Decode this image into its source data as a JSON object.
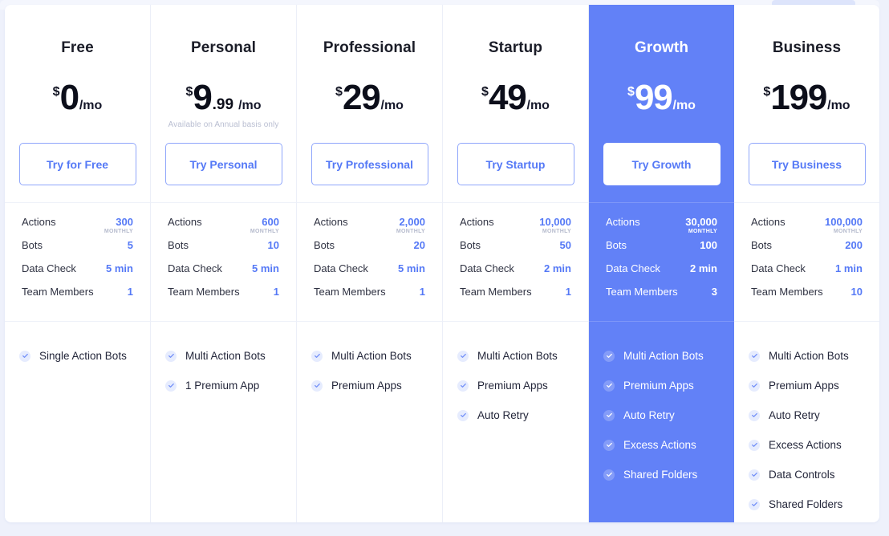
{
  "table": {
    "spec_labels": [
      "Actions",
      "Bots",
      "Data Check",
      "Team Members"
    ],
    "actions_caption": "MONTHLY",
    "accent_color": "#5579f6",
    "featured_bg_color": "#6281f7",
    "page_bg_color": "#eef1fb"
  },
  "plans": [
    {
      "name": "Free",
      "currency": "$",
      "amount": "0",
      "cents": "",
      "per": "/mo",
      "note": "",
      "cta_label": "Try for Free",
      "featured": false,
      "specs": {
        "actions": "300",
        "bots": "5",
        "data_check": "5 min",
        "team_members": "1"
      },
      "features": [
        "Single Action Bots"
      ]
    },
    {
      "name": "Personal",
      "currency": "$",
      "amount": "9",
      "cents": ".99",
      "per": "/mo",
      "note": "Available on Annual basis only",
      "cta_label": "Try Personal",
      "featured": false,
      "specs": {
        "actions": "600",
        "bots": "10",
        "data_check": "5 min",
        "team_members": "1"
      },
      "features": [
        "Multi Action Bots",
        "1 Premium App"
      ]
    },
    {
      "name": "Professional",
      "currency": "$",
      "amount": "29",
      "cents": "",
      "per": "/mo",
      "note": "",
      "cta_label": "Try Professional",
      "featured": false,
      "specs": {
        "actions": "2,000",
        "bots": "20",
        "data_check": "5 min",
        "team_members": "1"
      },
      "features": [
        "Multi Action Bots",
        "Premium Apps"
      ]
    },
    {
      "name": "Startup",
      "currency": "$",
      "amount": "49",
      "cents": "",
      "per": "/mo",
      "note": "",
      "cta_label": "Try Startup",
      "featured": false,
      "specs": {
        "actions": "10,000",
        "bots": "50",
        "data_check": "2 min",
        "team_members": "1"
      },
      "features": [
        "Multi Action Bots",
        "Premium Apps",
        "Auto Retry"
      ]
    },
    {
      "name": "Growth",
      "currency": "$",
      "amount": "99",
      "cents": "",
      "per": "/mo",
      "note": "",
      "cta_label": "Try Growth",
      "featured": true,
      "specs": {
        "actions": "30,000",
        "bots": "100",
        "data_check": "2 min",
        "team_members": "3"
      },
      "features": [
        "Multi Action Bots",
        "Premium Apps",
        "Auto Retry",
        "Excess Actions",
        "Shared Folders"
      ]
    },
    {
      "name": "Business",
      "currency": "$",
      "amount": "199",
      "cents": "",
      "per": "/mo",
      "note": "",
      "cta_label": "Try Business",
      "featured": false,
      "specs": {
        "actions": "100,000",
        "bots": "200",
        "data_check": "1 min",
        "team_members": "10"
      },
      "features": [
        "Multi Action Bots",
        "Premium Apps",
        "Auto Retry",
        "Excess Actions",
        "Data Controls",
        "Shared Folders"
      ]
    }
  ]
}
